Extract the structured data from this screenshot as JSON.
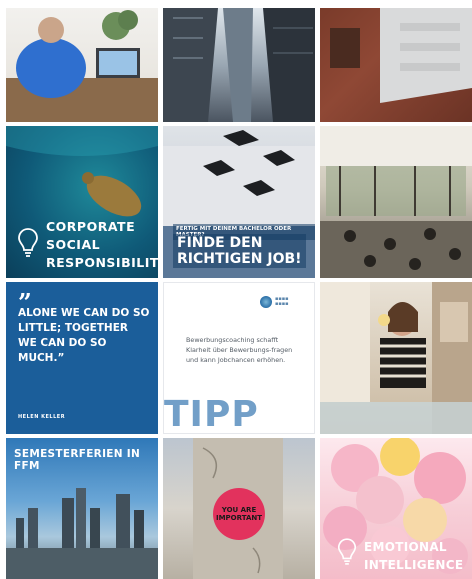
{
  "tiles": {
    "csr": {
      "lines": [
        "CORPORATE",
        "SOCIAL",
        "RESPONSIBILITY"
      ]
    },
    "job": {
      "small": "FERTIG MIT DEINEM BACHELOR ODER MASTER?",
      "big_line1": "FINDE DEN",
      "big_line2": "RICHTIGEN JOB!"
    },
    "quote": {
      "mark": "”",
      "text": "ALONE WE CAN DO SO LITTLE; TOGETHER WE CAN DO SO MUCH.”",
      "author": "HELEN KELLER"
    },
    "tipp": {
      "body": "Bewerbungscoaching schafft Klarheit über Bewerbungs-fragen und kann Jobchancen erhöhen.",
      "big": "TIPP"
    },
    "ffm": {
      "title": "SEMESTERFERIEN IN FFM"
    },
    "post": {
      "sticker": "YOU ARE IMPORTANT"
    },
    "balloons": {
      "line1": "EMOTIONAL",
      "line2": "INTELLIGENCE"
    }
  },
  "colors": {
    "quote_bg": "#1b5e9a",
    "tipp_text": "#5a8fbf",
    "sticker": "#e2325d"
  },
  "icons": [
    "bulb-icon",
    "logo-icon"
  ]
}
